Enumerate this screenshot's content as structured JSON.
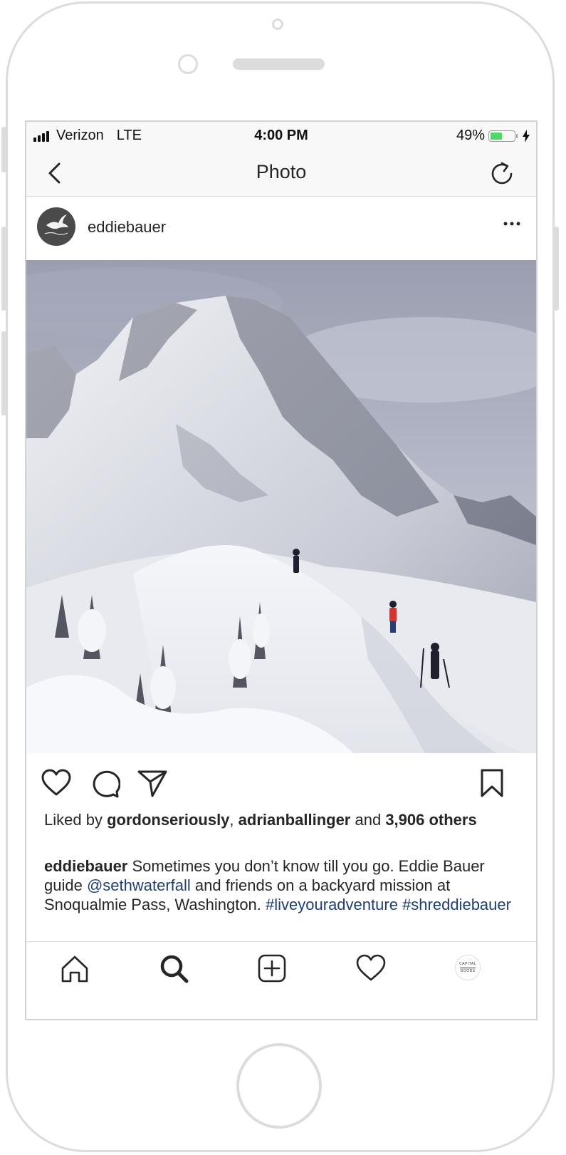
{
  "status_bar": {
    "carrier": "Verizon",
    "network": "LTE",
    "time": "4:00 PM",
    "battery_percent": "49%",
    "battery_level": 0.49,
    "battery_color": "#4cd964"
  },
  "nav": {
    "title": "Photo",
    "back_icon": "chevron-left-icon",
    "refresh_icon": "refresh-icon"
  },
  "post": {
    "username": "eddiebauer",
    "avatar_icon": "eddie-bauer-goose-logo",
    "more_icon": "ellipsis-icon",
    "photo_description_icon": "snowy-mountain-photo",
    "likes": {
      "prefix": "Liked by ",
      "user1": "gordonseriously",
      "sep": ", ",
      "user2": "adrianballinger",
      "and": " and ",
      "count": "3,906 others"
    },
    "caption": {
      "author": "eddiebauer",
      "text1": " Sometimes you don’t know till you go. Eddie Bauer guide ",
      "mention": "@sethwaterfall",
      "text2": " and friends on a backyard mission at Snoqualmie Pass, Washington. ",
      "hashtag1": "#liveyouradventure",
      "space": " ",
      "hashtag2": "#shreddiebauer",
      "link_color": "#1f3f6e"
    }
  },
  "tab_bar": {
    "profile_text_top": "CAPITAL",
    "profile_text_bottom": "GOODS"
  }
}
